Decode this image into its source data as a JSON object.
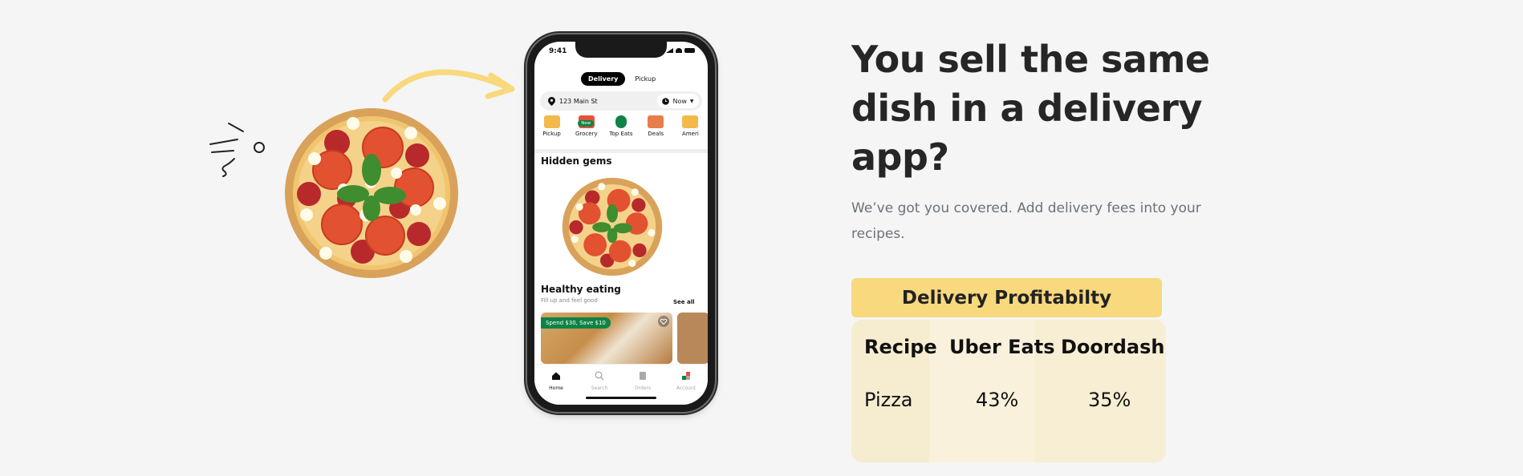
{
  "phone": {
    "status_time": "9:41",
    "mode_tabs": [
      "Delivery",
      "Pickup"
    ],
    "address": "123 Main St",
    "time_select": "Now",
    "categories": [
      {
        "label": "Pickup",
        "color": "#f3b94b"
      },
      {
        "label": "Grocery",
        "color": "#e3533b",
        "badge": "New"
      },
      {
        "label": "Top Eats",
        "color": "#0e8345"
      },
      {
        "label": "Deals",
        "color": "#e77d4a"
      },
      {
        "label": "Ameri",
        "color": "#f3b94b"
      }
    ],
    "section1_title": "Hidden gems",
    "section2_title": "Healthy eating",
    "section2_subtitle": "Fill up and feel good",
    "see_all": "See all",
    "promo": "Spend $30, Save $10",
    "tabs": [
      "Home",
      "Search",
      "Orders",
      "Account"
    ]
  },
  "hero": {
    "headline_lines": [
      "You sell the same",
      "dish in a delivery",
      "app?"
    ],
    "subtext": "We’ve got you covered. Add delivery fees into your recipes."
  },
  "profit": {
    "banner": "Delivery Profitabilty",
    "headers": [
      "Recipe",
      "Uber Eats",
      "Doordash"
    ],
    "row": [
      "Pizza",
      "43%",
      "35%"
    ]
  },
  "colors": {
    "banner": "#f8d97e",
    "table_bg": "#f7ecd0",
    "arrow": "#f8d97e",
    "brand_green": "#0e8345"
  }
}
